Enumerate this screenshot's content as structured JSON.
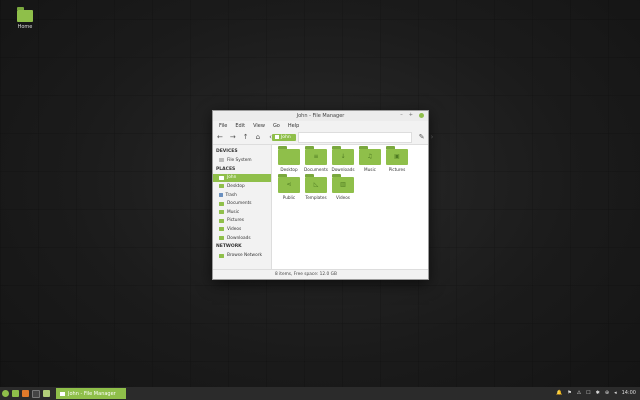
{
  "desktop": {
    "home_label": "Home"
  },
  "window": {
    "title": "John - File Manager",
    "controls": {
      "minimize": "–",
      "maximize": "+",
      "close": ""
    },
    "menu": [
      "File",
      "Edit",
      "View",
      "Go",
      "Help"
    ],
    "toolbar": {
      "back": "←",
      "forward": "→",
      "up": "↑",
      "home": "⌂",
      "toggle": "‹",
      "crumb": "John",
      "edit": "✎",
      "more": "›"
    },
    "sidebar": {
      "devices_header": "DEVICES",
      "devices": [
        "File System"
      ],
      "places_header": "PLACES",
      "places": [
        "John",
        "Desktop",
        "Trash",
        "Documents",
        "Music",
        "Pictures",
        "Videos",
        "Downloads"
      ],
      "network_header": "NETWORK",
      "network": [
        "Browse Network"
      ]
    },
    "files": [
      {
        "name": "Desktop",
        "glyph": ""
      },
      {
        "name": "Documents",
        "glyph": "≡"
      },
      {
        "name": "Downloads",
        "glyph": "↓"
      },
      {
        "name": "Music",
        "glyph": "♫"
      },
      {
        "name": "Pictures",
        "glyph": "▣"
      },
      {
        "name": "Public",
        "glyph": "⋖"
      },
      {
        "name": "Templates",
        "glyph": "◺"
      },
      {
        "name": "Videos",
        "glyph": "▥"
      }
    ],
    "status": "8 items, Free space: 12.0 GB"
  },
  "panel": {
    "task_label": "John - File Manager",
    "tray": {
      "clock": "14:00",
      "icons": [
        "🔔",
        "⚑",
        "⚠",
        "☐",
        "✱",
        "⊕",
        "◂"
      ]
    }
  },
  "colors": {
    "accent": "#8fbf4a",
    "panel": "#2b2b2b"
  }
}
